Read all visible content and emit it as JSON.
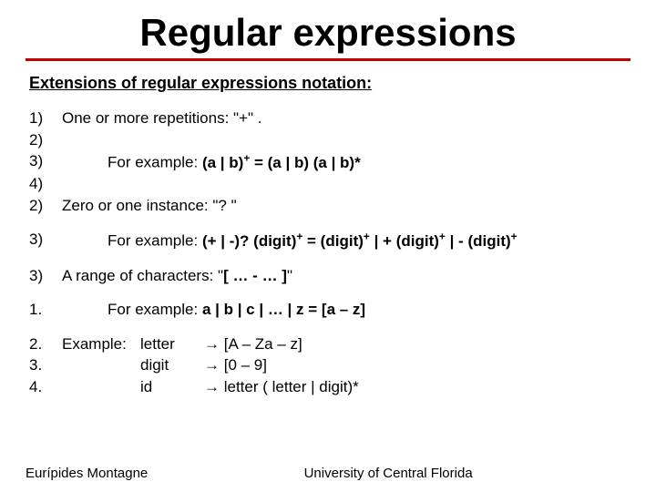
{
  "title": "Regular expressions",
  "subhead": "Extensions of regular expressions notation:",
  "markers": {
    "m1": "1)",
    "m2": "2)",
    "m3": "3)",
    "m4": "4)",
    "m5": "2)",
    "m6": "3)",
    "m7": "3)",
    "m8": "1.",
    "m9": "2.",
    "m10": "3.",
    "m11": "4."
  },
  "lines": {
    "l1": "One or more repetitions: \"+\" .",
    "l3_pre": "For example:  ",
    "l3_expr": "(a | b)+ = (a | b) (a | b)*",
    "l5": "Zero or one instance: \"? \"",
    "l6_pre": "For example: ",
    "l6_expr": "(+ | -)? (digit)+ = (digit)+ | + (digit)+ | - (digit)+",
    "l7": "A range of characters: \"[ … - … ]\"",
    "l8_pre": "For example: ",
    "l8_expr": "a | b | c | … | z = [a – z]",
    "l9_label": "Example:",
    "l9_lhs": "letter",
    "l9_rhs": "→ [A – Za – z]",
    "l10_lhs": "digit",
    "l10_rhs": "→ [0 – 9]",
    "l11_lhs": "id",
    "l11_rhs": "→ letter ( letter | digit)*"
  },
  "footer": {
    "left": "Eurípides Montagne",
    "right": "University of Central Florida"
  }
}
